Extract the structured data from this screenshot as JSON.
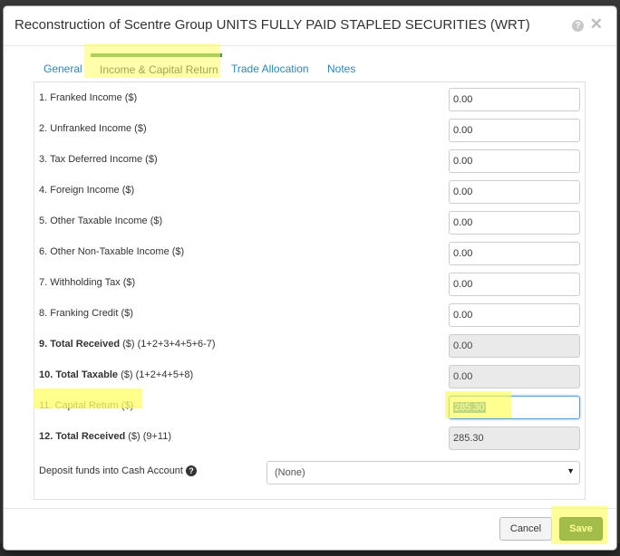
{
  "dialog": {
    "title": "Reconstruction of Scentre Group UNITS FULLY PAID STAPLED SECURITIES (WRT)",
    "help_glyph": "?",
    "close_glyph": "✕"
  },
  "tabs": [
    {
      "label": "General",
      "active": false
    },
    {
      "label": "Income & Capital Return",
      "active": true
    },
    {
      "label": "Trade Allocation",
      "active": false
    },
    {
      "label": "Notes",
      "active": false
    }
  ],
  "fields": [
    {
      "label_bold": "",
      "label": "1. Franked Income ($)",
      "value": "0.00",
      "readonly": false
    },
    {
      "label_bold": "",
      "label": "2. Unfranked Income ($)",
      "value": "0.00",
      "readonly": false
    },
    {
      "label_bold": "",
      "label": "3. Tax Deferred Income ($)",
      "value": "0.00",
      "readonly": false
    },
    {
      "label_bold": "",
      "label": "4. Foreign Income ($)",
      "value": "0.00",
      "readonly": false
    },
    {
      "label_bold": "",
      "label": "5. Other Taxable Income ($)",
      "value": "0.00",
      "readonly": false
    },
    {
      "label_bold": "",
      "label": "6. Other Non-Taxable Income ($)",
      "value": "0.00",
      "readonly": false
    },
    {
      "label_bold": "",
      "label": "7. Withholding Tax ($)",
      "value": "0.00",
      "readonly": false
    },
    {
      "label_bold": "",
      "label": "8. Franking Credit ($)",
      "value": "0.00",
      "readonly": false
    },
    {
      "label_bold": "9. Total Received",
      "label": " ($) (1+2+3+4+5+6-7)",
      "value": "0.00",
      "readonly": true
    },
    {
      "label_bold": "10. Total Taxable",
      "label": " ($) (1+2+4+5+8)",
      "value": "0.00",
      "readonly": true
    },
    {
      "label_bold": "",
      "label": "11. Capital Return ($)",
      "value": "285.30",
      "readonly": false
    },
    {
      "label_bold": "12. Total Received",
      "label": " ($) (9+11)",
      "value": "285.30",
      "readonly": true
    }
  ],
  "deposit": {
    "label": "Deposit funds into Cash Account",
    "help_glyph": "?",
    "selected": "(None)",
    "caret": "▼"
  },
  "footer": {
    "cancel_label": "Cancel",
    "save_label": "Save"
  },
  "colors": {
    "tab_accent": "#4a9a3f",
    "link": "#2a86b8",
    "save_bg": "#185a3a",
    "highlight": "#ffff66"
  }
}
